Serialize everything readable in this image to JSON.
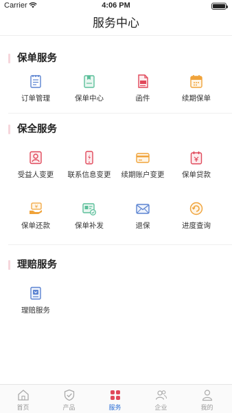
{
  "status_bar": {
    "carrier": "Carrier",
    "time": "4:06 PM"
  },
  "header": {
    "title": "服务中心"
  },
  "sections": [
    {
      "title": "保单服务",
      "items": [
        {
          "label": "订单管理",
          "icon": "order-list-icon"
        },
        {
          "label": "保单中心",
          "icon": "policy-center-icon"
        },
        {
          "label": "函件",
          "icon": "letter-document-icon"
        },
        {
          "label": "续期保单",
          "icon": "renewal-calendar-icon"
        }
      ]
    },
    {
      "title": "保全服务",
      "items": [
        {
          "label": "受益人变更",
          "icon": "beneficiary-icon"
        },
        {
          "label": "联系信息变更",
          "icon": "phone-contact-icon"
        },
        {
          "label": "续期账户变更",
          "icon": "bank-card-icon"
        },
        {
          "label": "保单贷款",
          "icon": "loan-calendar-icon"
        },
        {
          "label": "保单还款",
          "icon": "repayment-hand-icon"
        },
        {
          "label": "保单补发",
          "icon": "reissue-card-icon"
        },
        {
          "label": "退保",
          "icon": "surrender-mail-icon"
        },
        {
          "label": "进度查询",
          "icon": "progress-query-icon"
        }
      ]
    },
    {
      "title": "理赔服务",
      "items": [
        {
          "label": "理赔服务",
          "icon": "claim-document-icon"
        }
      ]
    }
  ],
  "tab_bar": {
    "active": "服务",
    "tabs": [
      {
        "label": "首页",
        "icon": "home-icon"
      },
      {
        "label": "产品",
        "icon": "shield-check-icon"
      },
      {
        "label": "服务",
        "icon": "service-grid-icon"
      },
      {
        "label": "企业",
        "icon": "enterprise-users-icon"
      },
      {
        "label": "我的",
        "icon": "person-icon"
      }
    ]
  },
  "colors": {
    "accent": "#2d6fd6",
    "section_bar": "#f6d6dc",
    "icon_blue": "#5b83d1",
    "icon_green": "#5bbf9a",
    "icon_red": "#e0485a",
    "icon_orange": "#f0a33a"
  }
}
